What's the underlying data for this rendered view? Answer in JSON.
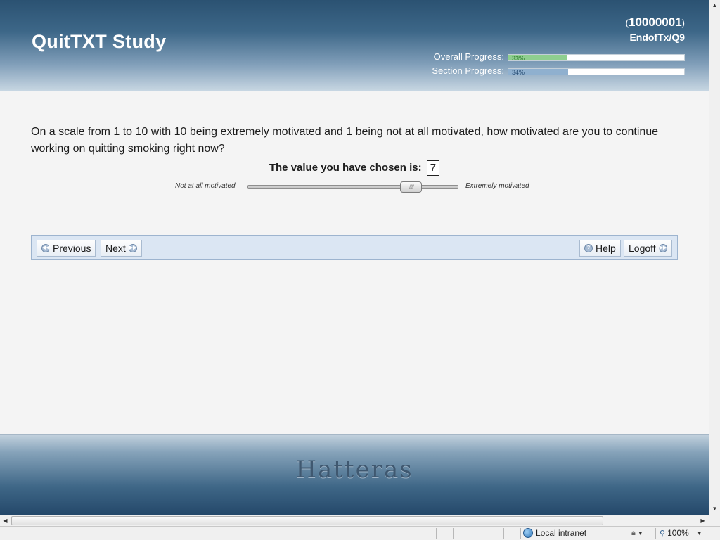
{
  "header": {
    "title": "QuitTXT Study",
    "participant_open": "(",
    "participant_id": "10000001",
    "participant_close": ")",
    "section_code": "EndofTx/Q9",
    "overall": {
      "label": "Overall Progress:",
      "percent_text": "33%",
      "value": 0.33
    },
    "section": {
      "label": "Section Progress:",
      "percent_text": "34%",
      "value": 0.34
    }
  },
  "question": {
    "text": "On a scale from 1 to 10 with 10 being extremely motivated and 1 being not at all motivated, how motivated are you to continue working on quitting smoking right now?",
    "chosen_label": "The value you have chosen is:",
    "chosen_value": "7",
    "min_label": "Not at all motivated",
    "max_label": "Extremely motivated",
    "slider_min": 1,
    "slider_max": 10,
    "slider_value": 7
  },
  "nav": {
    "previous": "Previous",
    "next": "Next",
    "help": "Help",
    "logoff": "Logoff"
  },
  "footer": {
    "logo_text": "Hatteras"
  },
  "statusbar": {
    "zone": "Local intranet",
    "zoom": "100%"
  }
}
